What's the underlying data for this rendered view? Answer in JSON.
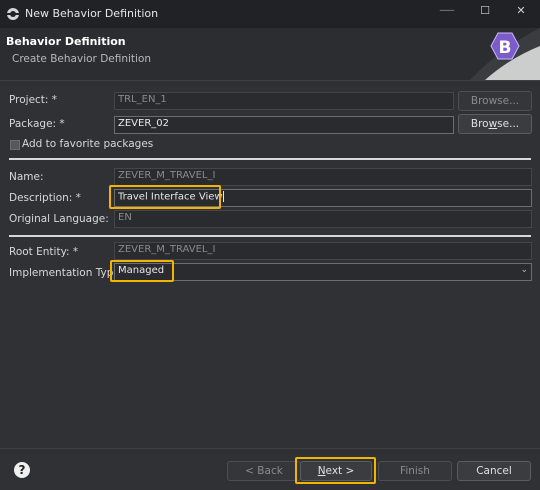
{
  "window": {
    "title": "New Behavior Definition",
    "controls": {
      "minimize": "—",
      "maximize": "☐",
      "close": "✕"
    }
  },
  "header": {
    "title": "Behavior Definition",
    "subtitle": "Create Behavior Definition",
    "logo_letter": "B"
  },
  "form": {
    "project": {
      "label": "Project: *",
      "value": "TRL_EN_1",
      "browse": "Browse..."
    },
    "package": {
      "label": "Package: *",
      "value": "ZEVER_02",
      "browse_prefix": "Bro",
      "browse_underline": "w",
      "browse_suffix": "se..."
    },
    "favorite": {
      "label": "Add to favorite packages",
      "checked": false
    },
    "name": {
      "label": "Name:",
      "value": "ZEVER_M_TRAVEL_I"
    },
    "description": {
      "label": "Description: *",
      "value": "Travel Interface View"
    },
    "original_language": {
      "label": "Original Language:",
      "value": "EN"
    },
    "root_entity": {
      "label": "Root Entity: *",
      "value": "ZEVER_M_TRAVEL_I"
    },
    "implementation_type": {
      "label": "Implementation Type: *",
      "value": "Managed"
    }
  },
  "footer": {
    "help": "?",
    "back": "< Back",
    "next_underline": "N",
    "next_rest": "ext >",
    "finish": "Finish",
    "cancel": "Cancel"
  },
  "colors": {
    "highlight": "#f2b400",
    "background": "#2f3135",
    "logo": "#7b5cc9"
  }
}
